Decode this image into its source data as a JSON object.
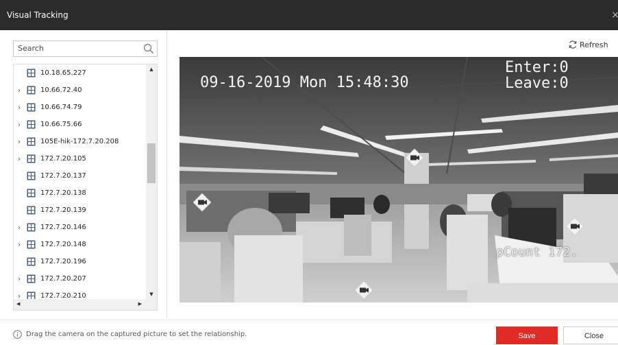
{
  "window": {
    "title": "Visual Tracking",
    "close_glyph": "×"
  },
  "search": {
    "placeholder": "Search",
    "icon": "search-icon"
  },
  "tree": {
    "items": [
      {
        "label": "10.18.65.227",
        "expandable": false
      },
      {
        "label": "10.66.72.40",
        "expandable": true
      },
      {
        "label": "10.66.74.79",
        "expandable": true
      },
      {
        "label": "10.66.75.66",
        "expandable": true
      },
      {
        "label": "105E-hik-172.7.20.208",
        "expandable": true
      },
      {
        "label": "172.7.20.105",
        "expandable": true
      },
      {
        "label": "172.7.20.137",
        "expandable": false
      },
      {
        "label": "172.7.20.138",
        "expandable": false
      },
      {
        "label": "172.7.20.139",
        "expandable": false
      },
      {
        "label": "172.7.20.146",
        "expandable": true
      },
      {
        "label": "172.7.20.148",
        "expandable": true
      },
      {
        "label": "172.7.20.196",
        "expandable": false
      },
      {
        "label": "172.7.20.207",
        "expandable": true
      },
      {
        "label": "172.7.20.210",
        "expandable": true
      }
    ]
  },
  "toolbar": {
    "refresh_label": "Refresh"
  },
  "video": {
    "osd_datetime": "09-16-2019 Mon 15:48:30",
    "osd_enter": "Enter:0",
    "osd_leave": "Leave:0",
    "osd_camera": "pCount 172.",
    "camera_marker_count": 4
  },
  "footer": {
    "hint": "Drag the camera on the captured picture to set the relationship.",
    "save_label": "Save",
    "close_label": "Close"
  },
  "colors": {
    "titlebar": "#2b2b2b",
    "accent": "#e02b27"
  }
}
